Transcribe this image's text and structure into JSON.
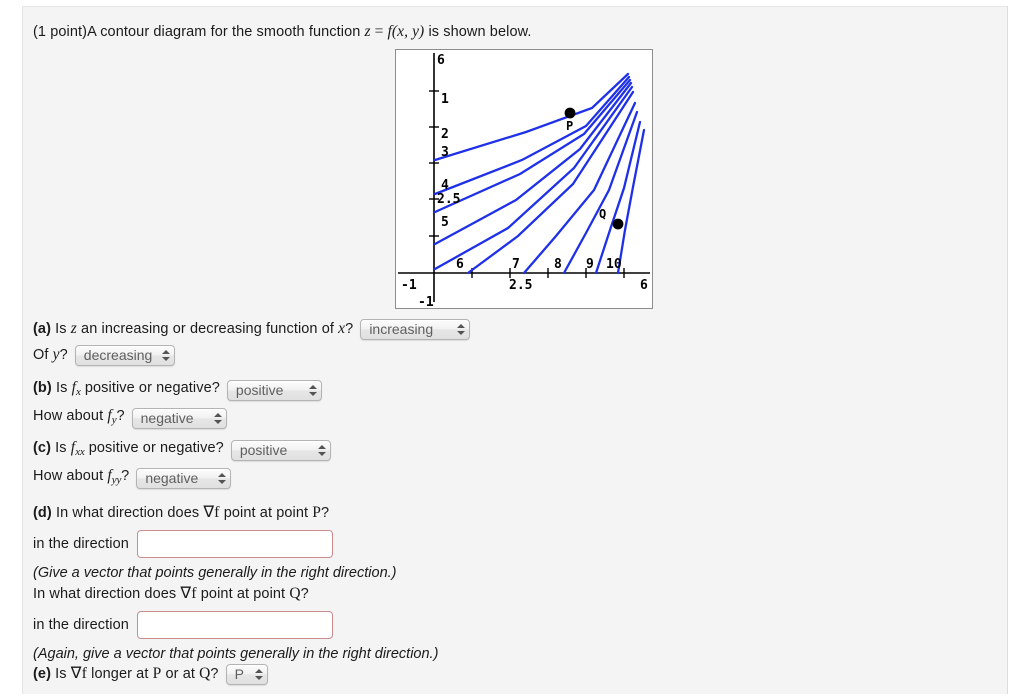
{
  "header": {
    "points": "(1 point)",
    "line_pre": "A contour diagram for the smooth function ",
    "eq_z": "z",
    "eq_equals": " = ",
    "eq_f": "f",
    "eq_args": "(x, y)",
    "line_post": " is shown below."
  },
  "figure": {
    "y_axis_labels": [
      "6",
      "2.5",
      "-1"
    ],
    "x_axis_labels": [
      "-1",
      "2.5",
      "6"
    ],
    "contour_labels": [
      "1",
      "2",
      "3",
      "4",
      "5",
      "6",
      "7",
      "8",
      "9",
      "10"
    ],
    "points": [
      {
        "name": "P",
        "label": "P"
      },
      {
        "name": "Q",
        "label": "Q"
      }
    ],
    "contour_color": "#1f31e8",
    "axis_color": "#000000",
    "frame_color": "#8d8d8d"
  },
  "questions": {
    "a": {
      "tag": "(a)",
      "text_1": "Is ",
      "var_z": "z",
      "text_2": " an increasing or decreasing function of ",
      "var_x": "x",
      "text_3": "?",
      "select_1": "increasing",
      "line2_pre": "Of ",
      "var_y": "y",
      "line2_post": "?",
      "select_2": "decreasing"
    },
    "b": {
      "tag": "(b)",
      "text_1": "Is ",
      "fn": "f",
      "sub_1": "x",
      "text_2": " positive or negative?",
      "select_1": "positive",
      "line2_pre": "How about ",
      "sub_2": "y",
      "line2_post": "?",
      "select_2": "negative"
    },
    "c": {
      "tag": "(c)",
      "text_1": "Is ",
      "fn": "f",
      "sub_1": "xx",
      "text_2": " positive or negative?",
      "select_1": "positive",
      "line2_pre": "How about ",
      "sub_2": "yy",
      "line2_post": "?",
      "select_2": "negative"
    },
    "d": {
      "tag": "(d)",
      "text_1": "In what direction does ",
      "grad": "∇f",
      "text_2": " point at point ",
      "point_1": "P",
      "text_3": "?",
      "dir_label_1": "in the direction",
      "input_1_value": "",
      "input_1_placeholder": "",
      "note_1": "(Give a vector that points generally in the right direction.)",
      "line_q_pre": "In what direction does ",
      "line_q_mid": " point at point ",
      "point_2": "Q",
      "line_q_post": "?",
      "dir_label_2": "in the direction",
      "input_2_value": "",
      "input_2_placeholder": "",
      "note_2": "(Again, give a vector that points generally in the right direction.)"
    },
    "e": {
      "tag": "(e)",
      "text_1": "Is ",
      "grad": "∇f",
      "text_2": " longer at ",
      "point_1": "P",
      "text_3": " or at ",
      "point_2": "Q",
      "text_4": "?",
      "select_1": "P"
    }
  },
  "chart_data": {
    "type": "line",
    "title": "",
    "xlabel": "",
    "ylabel": "",
    "xlim": [
      -1,
      6
    ],
    "ylim": [
      -1,
      6
    ],
    "xticks": [
      -1,
      2.5,
      6
    ],
    "yticks": [
      -1,
      2.5,
      6
    ],
    "grid": false,
    "description": "Contour diagram of z = f(x,y); ten level curves labeled 1 through 10 fan out from a convergence region near the upper-right corner of the first quadrant. Lower-numbered contours (1-5) enter along the left (y) axis with shallow upward slopes; higher-numbered contours (6-10) cross the bottom (x) axis with steep slopes.",
    "contours": [
      {
        "level": 1,
        "label_xy": [
          0.35,
          4.35
        ],
        "start": [
          0.0,
          4.05
        ],
        "end": [
          5.2,
          5.75
        ]
      },
      {
        "level": 2,
        "label_xy": [
          0.35,
          3.45
        ],
        "start": [
          0.0,
          3.1
        ],
        "end": [
          5.3,
          5.6
        ]
      },
      {
        "level": 3,
        "label_xy": [
          0.35,
          2.95
        ],
        "start": [
          0.0,
          2.6
        ],
        "end": [
          5.4,
          5.5
        ]
      },
      {
        "level": 4,
        "label_xy": [
          0.35,
          2.05
        ],
        "start": [
          0.0,
          1.75
        ],
        "end": [
          5.45,
          5.4
        ]
      },
      {
        "level": 5,
        "label_xy": [
          0.35,
          1.15
        ],
        "start": [
          0.0,
          0.85
        ],
        "end": [
          5.5,
          5.3
        ]
      },
      {
        "level": 6,
        "label_xy": [
          0.75,
          0.15
        ],
        "start": [
          0.95,
          0.0
        ],
        "end": [
          5.55,
          5.2
        ]
      },
      {
        "level": 7,
        "label_xy": [
          2.35,
          0.15
        ],
        "start": [
          2.55,
          0.0
        ],
        "end": [
          5.6,
          5.1
        ]
      },
      {
        "level": 8,
        "label_xy": [
          3.55,
          0.15
        ],
        "start": [
          3.65,
          0.0
        ],
        "end": [
          5.65,
          5.0
        ]
      },
      {
        "level": 9,
        "label_xy": [
          4.45,
          0.15
        ],
        "start": [
          4.6,
          0.0
        ],
        "end": [
          5.7,
          4.9
        ]
      },
      {
        "level": 10,
        "label_xy": [
          5.05,
          0.15
        ],
        "start": [
          5.15,
          0.0
        ],
        "end": [
          5.75,
          4.8
        ]
      }
    ],
    "marked_points": [
      {
        "name": "P",
        "x": 3.75,
        "y": 5.25
      },
      {
        "name": "Q",
        "x": 4.95,
        "y": 0.95
      }
    ]
  }
}
